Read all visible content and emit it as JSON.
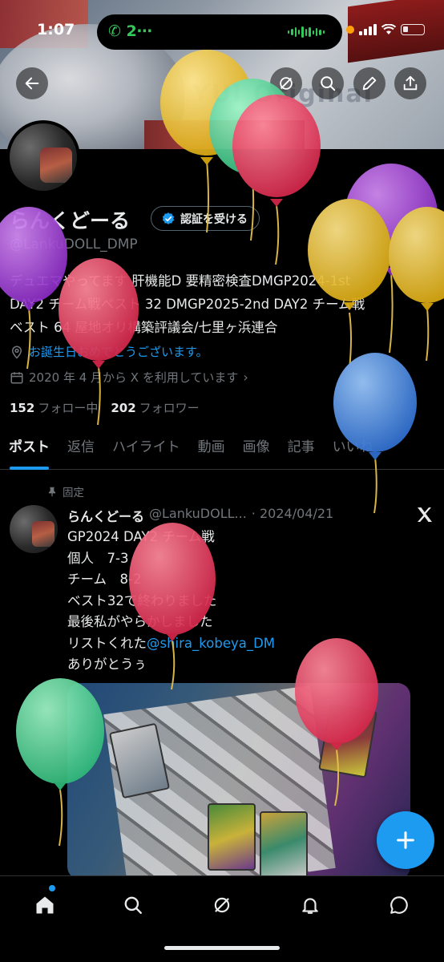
{
  "status_bar": {
    "time": "1:07",
    "call_label": "2⋯"
  },
  "banner": {
    "watermark": "YUI Original"
  },
  "header_buttons": [
    "back-icon",
    "grok-icon",
    "search-icon",
    "edit-icon",
    "share-icon"
  ],
  "profile": {
    "name": "らんくどーる",
    "verify_button": "認証を受ける",
    "handle": "@LankuDOLL_DMP",
    "bio_line1": "デュエマやってます 肝機能D 要精密検査DMGP2024-1st",
    "bio_line2": "DAY2 チーム戦ベスト 32 DMGP2025-2nd DAY2 チーム戦",
    "bio_line3": "ベスト 64 屋地オリ構築評議会/七里ヶ浜連合",
    "birthday": "お誕生日おめでとうございます。",
    "joined": "2020 年 4 月から X を利用しています",
    "following_count": "152",
    "following_label": "フォロー中",
    "followers_count": "202",
    "followers_label": "フォロワー"
  },
  "tabs": [
    "ポスト",
    "返信",
    "ハイライト",
    "動画",
    "画像",
    "記事",
    "いいね"
  ],
  "pinned_post": {
    "pinned_label": "固定",
    "author": "らんくどーる",
    "handle": "@LankuDOLL...",
    "date": "· 2024/04/21",
    "lines": [
      "GP2024 DAY2 チーム戦",
      "個人　7-3",
      "チーム　8-2",
      "ベスト32で終わりました",
      "最後私がやらかしました"
    ],
    "mention_prefix": "リストくれた",
    "mention": "@shira_kobeya_DM",
    "last_line": "ありがとうぅ"
  },
  "colors": {
    "accent": "#1d9bf0",
    "background": "#000000",
    "text": "#e7e9ea",
    "secondary": "#71767b"
  },
  "bottom_nav": [
    "home-icon",
    "search-icon",
    "grok-icon",
    "notifications-icon",
    "messages-icon"
  ]
}
